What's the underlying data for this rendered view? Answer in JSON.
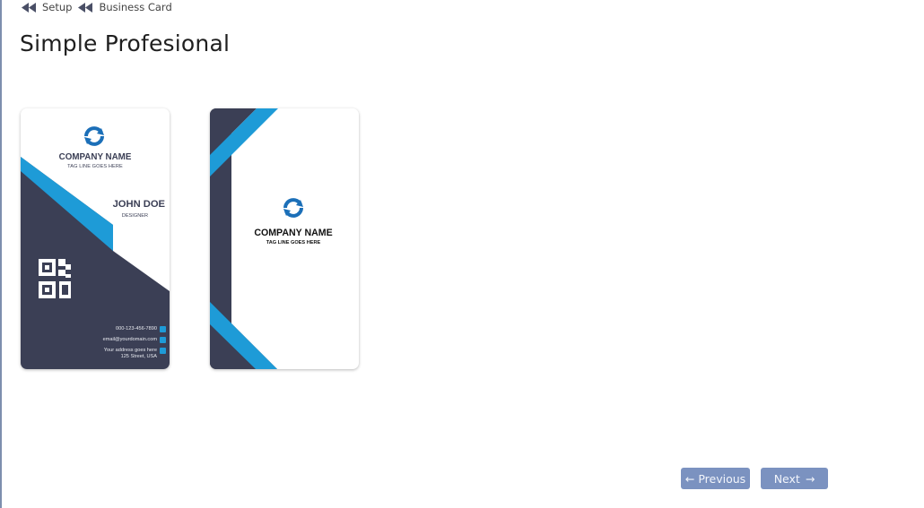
{
  "breadcrumb": {
    "items": [
      {
        "label": "Setup"
      },
      {
        "label": "Business Card"
      }
    ]
  },
  "page": {
    "title": "Simple Profesional"
  },
  "cards": {
    "front": {
      "company": "COMPANY NAME",
      "tagline": "TAG LINE GOES HERE",
      "name": "JOHN DOE",
      "position": "DESIGNER",
      "phone": "000-123-456-7890",
      "email": "email@yourdomain.com",
      "address_line1": "Your address goes here",
      "address_line2": "125 Street, USA"
    },
    "back": {
      "company": "COMPANY NAME",
      "tagline": "TAG LINE GOES HERE"
    }
  },
  "colors": {
    "navy": "#3b3f55",
    "accent": "#1e9bd7",
    "logo": "#1b6fb8",
    "button": "#7b92c0"
  },
  "icons": {
    "breadcrumb": "double-left-arrow-icon",
    "prev": "arrow-left-icon",
    "next": "arrow-right-icon"
  },
  "nav": {
    "previous_label": "Previous",
    "next_label": "Next",
    "previous_arrow": "←",
    "next_arrow": "→"
  }
}
